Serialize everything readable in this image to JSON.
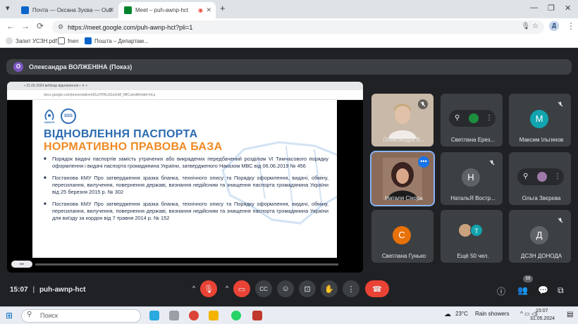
{
  "browser": {
    "tabs": [
      {
        "title": "Почта — Оксана Зуєва — Outl",
        "active": false
      },
      {
        "title": "Meet – puh-awnp-hct",
        "active": true
      }
    ],
    "url": "https://meet.google.com/puh-awnp-hct?pli=1",
    "profile_initial": "Д",
    "bookmarks": [
      "Запит УСЗН.pdf",
      "fnen",
      "Пошта – Департам..."
    ]
  },
  "meet": {
    "presenter_initial": "О",
    "presenter_label": "Олександра ВОЛЖЕНІНА (Показ)",
    "slide": {
      "logo_left": "UNHCR",
      "logo_right": "SSS",
      "title_line1": "ВІДНОВЛЕННЯ ПАСПОРТА",
      "title_line2": "НОРМАТИВНО ПРАВОВА БАЗА",
      "bullets": [
        "Порядок видачі паспортів замість утрачених або викрадених передбачений розділом VI Тимчасового порядку оформлення і видачі паспорта громадянина України, затвердженого Наказом МВС від 06.06.2019  № 456",
        "Постанова КМУ Про затвердження зразка бланка, технічного опису та Порядку оформлення, видачі, обміну, пересилання, вилучення, повернення державі, визнання недійсним та знищення паспорта громадянина України від 25 березня 2015 р. № 302",
        "Постанова КМУ Про затвердження зразка бланка, технічного опису та Порядку оформлення, видачі, обміну, пересилання, вилучення, повернення державі, визнання недійсним та знищення паспорта громадянина України для виїзду за кордон від 7 травня 2014 р. № 152"
      ]
    },
    "participants": [
      {
        "name": "Олександра В...",
        "initial": "",
        "color": "#c9b9a8"
      },
      {
        "name": "Светлана Ерез...",
        "initial": "",
        "color": "#5f6368"
      },
      {
        "name": "Максим Ільгинов",
        "initial": "М",
        "color": "#12a4af"
      },
      {
        "name": "Наталя Сікора",
        "initial": "",
        "color": "#8a6a58"
      },
      {
        "name": "НатальЯ Востр...",
        "initial": "Н",
        "color": "#5f6368"
      },
      {
        "name": "Ольга Звєрєва",
        "initial": "",
        "color": "#5f6368"
      },
      {
        "name": "Светлана Гунько",
        "initial": "С",
        "color": "#e8710a"
      },
      {
        "name": "Ещё 50 чел.",
        "initial": "Т",
        "color": "#12a4af"
      },
      {
        "name": "ДСЗН ДОНОДА",
        "initial": "Д",
        "color": "#5f6368"
      }
    ],
    "time": "15:07",
    "meeting_code": "puh-awnp-hct",
    "participant_count": "59"
  },
  "taskbar": {
    "search_placeholder": "Поиск",
    "weather": "23°C",
    "weather_text": "Rain showers",
    "clock_time": "15:07",
    "clock_date": "31.05.2024"
  },
  "colors": {
    "accent": "#8ab4f8",
    "end_call": "#ea4335",
    "bg": "#202124",
    "tile": "#3c4043"
  }
}
